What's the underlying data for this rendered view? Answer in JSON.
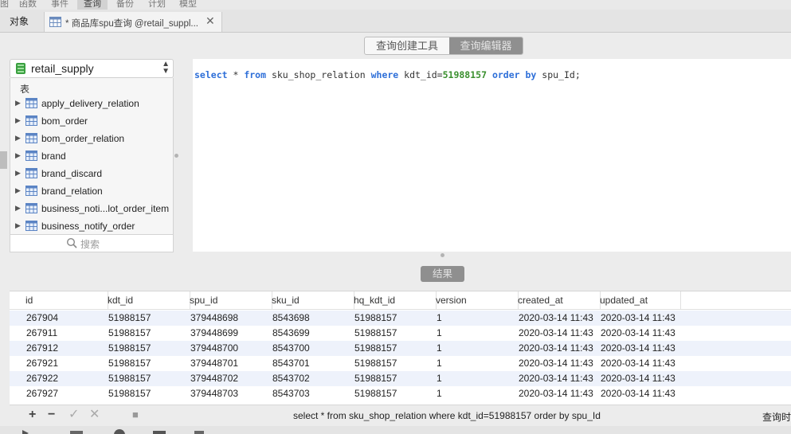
{
  "menubar": {
    "items": [
      "图",
      "函数",
      "事件",
      "查询",
      "备份",
      "计划",
      "模型"
    ]
  },
  "tabs": {
    "objects_label": "对象",
    "query_tab_label": "* 商品库spu查询 @retail_suppl...",
    "close_glyph": "✕"
  },
  "mode_toggle": {
    "builder_label": "查询创建工具",
    "editor_label": "查询编辑器"
  },
  "database": {
    "name": "retail_supply"
  },
  "tree": {
    "heading": "表",
    "tables": [
      "apply_delivery_relation",
      "bom_order",
      "bom_order_relation",
      "brand",
      "brand_discard",
      "brand_relation",
      "business_noti...lot_order_item",
      "business_notify_order"
    ]
  },
  "object_search": {
    "placeholder": "搜索"
  },
  "editor": {
    "sql_parts": {
      "k_select": "select",
      "t1": " * ",
      "k_from": "from",
      "t2": " sku_shop_relation ",
      "k_where": "where",
      "t3": " kdt_id=",
      "n1": "51988157",
      "t4": " ",
      "k_order": "order",
      "t5": " ",
      "k_by": "by",
      "t6": " spu_Id;"
    }
  },
  "results": {
    "label": "结果",
    "columns": [
      "id",
      "kdt_id",
      "spu_id",
      "sku_id",
      "hq_kdt_id",
      "version",
      "created_at",
      "updated_at"
    ],
    "rows": [
      [
        "267904",
        "51988157",
        "379448698",
        "8543698",
        "51988157",
        "1",
        "2020-03-14 11:43",
        "2020-03-14 11:43"
      ],
      [
        "267911",
        "51988157",
        "379448699",
        "8543699",
        "51988157",
        "1",
        "2020-03-14 11:43",
        "2020-03-14 11:43"
      ],
      [
        "267912",
        "51988157",
        "379448700",
        "8543700",
        "51988157",
        "1",
        "2020-03-14 11:43",
        "2020-03-14 11:43"
      ],
      [
        "267921",
        "51988157",
        "379448701",
        "8543701",
        "51988157",
        "1",
        "2020-03-14 11:43",
        "2020-03-14 11:43"
      ],
      [
        "267922",
        "51988157",
        "379448702",
        "8543702",
        "51988157",
        "1",
        "2020-03-14 11:43",
        "2020-03-14 11:43"
      ],
      [
        "267927",
        "51988157",
        "379448703",
        "8543703",
        "51988157",
        "1",
        "2020-03-14 11:43",
        "2020-03-14 11:43"
      ]
    ]
  },
  "bottombar": {
    "add_glyph": "+",
    "remove_glyph": "−",
    "apply_glyph": "✓",
    "discard_glyph": "✕",
    "stop_glyph": "■",
    "status_sql": "select * from sku_shop_relation where kdt_id=51988157 order by spu_Id",
    "status_time": "查询时间"
  },
  "colors": {
    "keyword": "#2e6fd8",
    "number_literal": "#3a8f2e",
    "active_toggle": "#8f8f8f",
    "row_alt": "#eef2fb"
  },
  "icons": {
    "query_tab": "query-table-icon",
    "database": "database-icon",
    "table": "table-icon",
    "search": "search-icon",
    "expand": "triangle-right-icon"
  }
}
